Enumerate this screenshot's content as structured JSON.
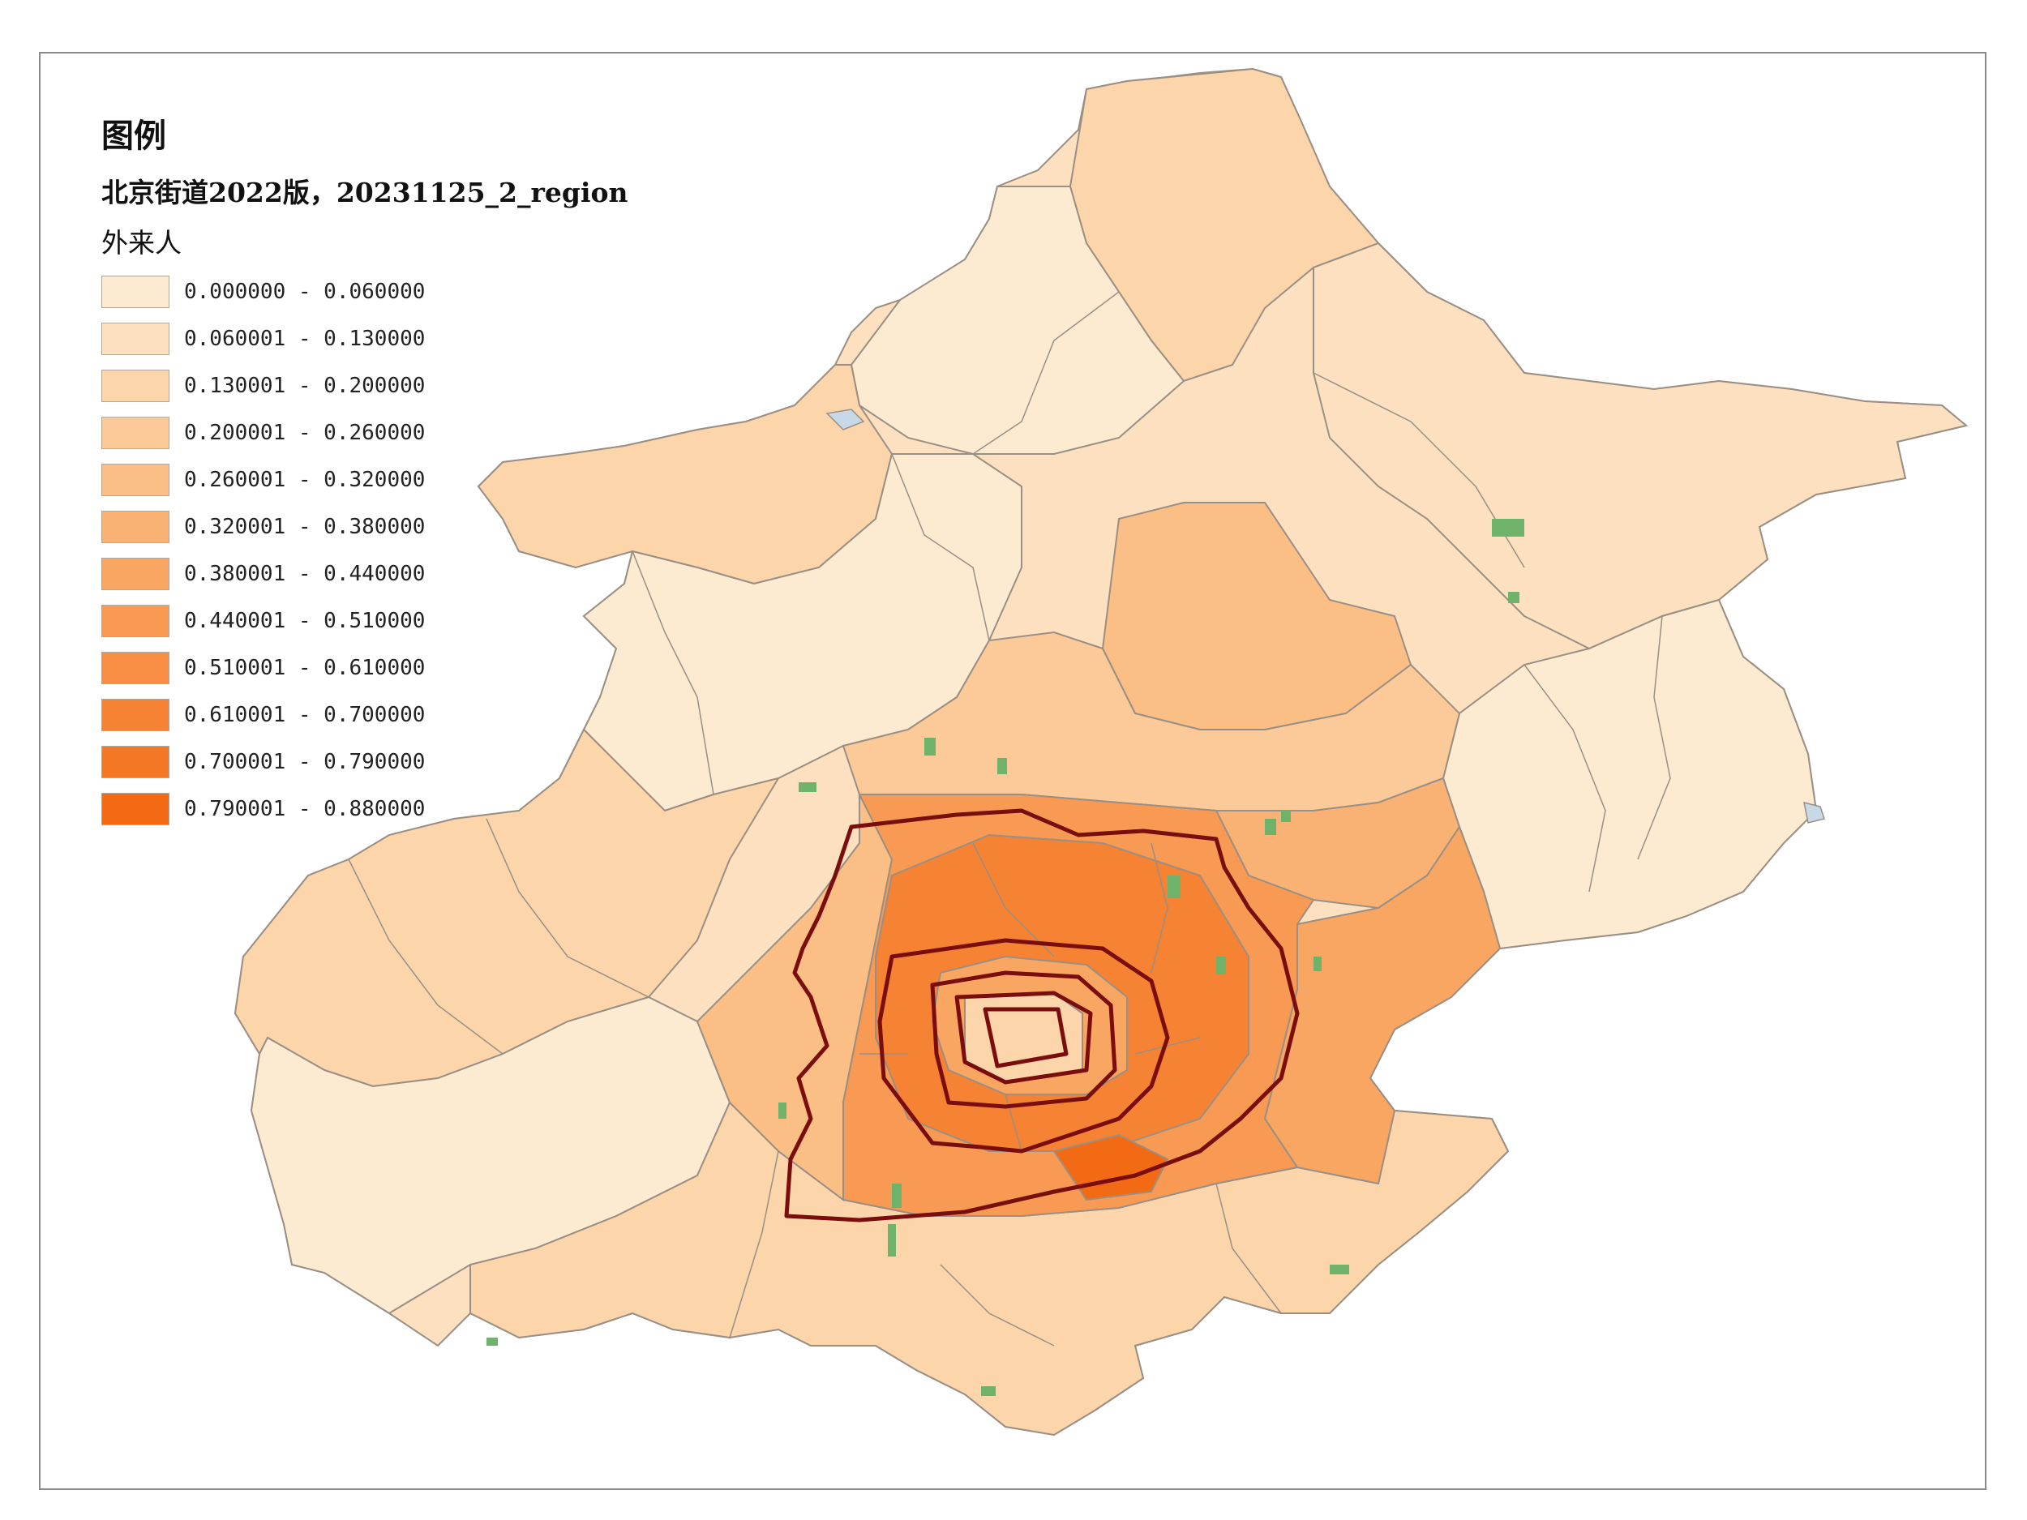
{
  "legend": {
    "heading": "图例",
    "layer": "北京街道2022版，20231125_2_region",
    "field": "外来人",
    "classes": [
      {
        "range": "0.000000 - 0.060000",
        "color": "#fdebd1"
      },
      {
        "range": "0.060001 - 0.130000",
        "color": "#fde0bf"
      },
      {
        "range": "0.130001 - 0.200000",
        "color": "#fcd5ab"
      },
      {
        "range": "0.200001 - 0.260000",
        "color": "#fcca98"
      },
      {
        "range": "0.260001 - 0.320000",
        "color": "#fbbe85"
      },
      {
        "range": "0.320001 - 0.380000",
        "color": "#fab274"
      },
      {
        "range": "0.380001 - 0.440000",
        "color": "#f9a663"
      },
      {
        "range": "0.440001 - 0.510000",
        "color": "#f89a53"
      },
      {
        "range": "0.510001 - 0.610000",
        "color": "#f78e43"
      },
      {
        "range": "0.610001 - 0.700000",
        "color": "#f68234"
      },
      {
        "range": "0.700001 - 0.790000",
        "color": "#f47725"
      },
      {
        "range": "0.790001 - 0.880000",
        "color": "#f26b14"
      }
    ]
  },
  "map": {
    "ring_road_color": "#7a0d0d",
    "boundary_color": "#9a8f84",
    "water_color": "#c7d8e6",
    "park_color": "#6fb36a"
  }
}
